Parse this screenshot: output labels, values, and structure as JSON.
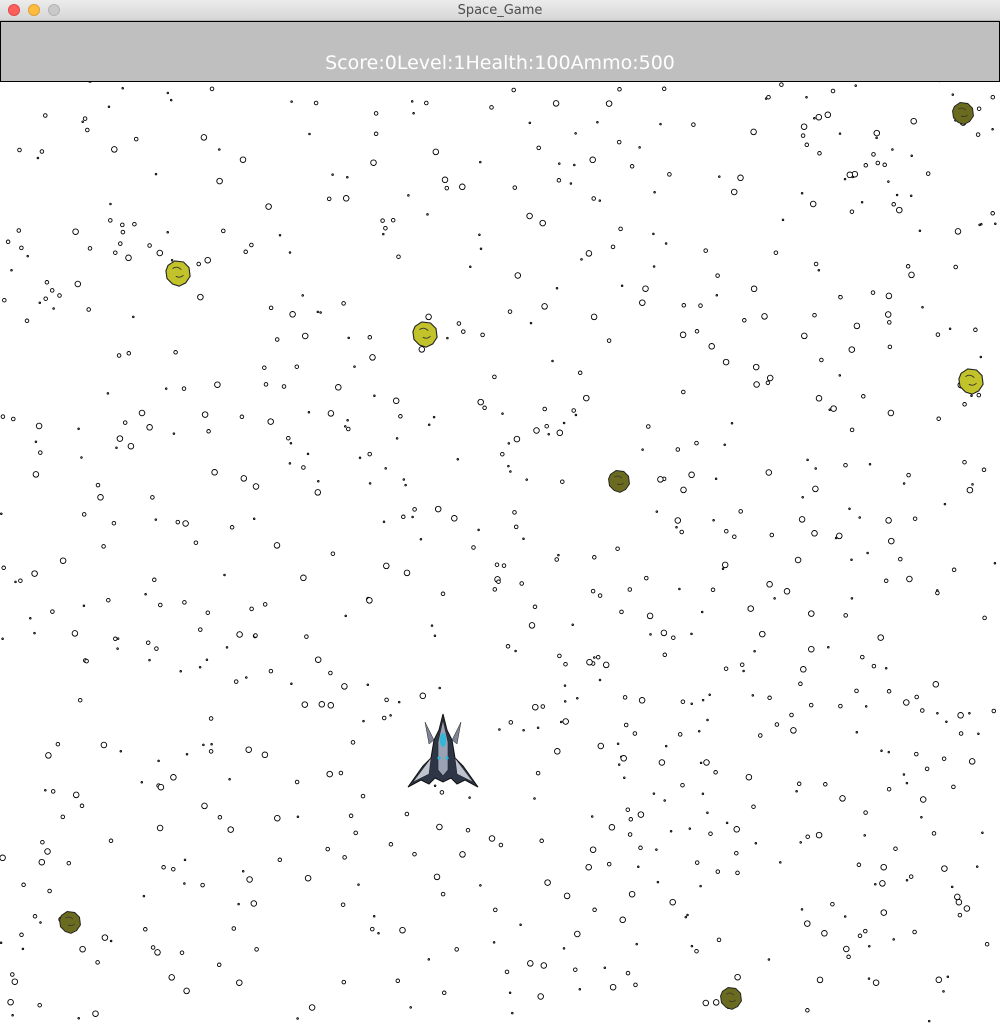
{
  "window": {
    "title": "Space_Game",
    "controls": [
      "close-button",
      "minimize-button",
      "zoom-button"
    ]
  },
  "hud": {
    "score_label": "Score:",
    "score_value": "0",
    "level_label": "Level:",
    "level_value": "1",
    "health_label": "Health:",
    "health_value": "100",
    "ammo_label": "Ammo:",
    "ammo_value": "500",
    "background_color": "#bfbfbf",
    "text_color": "#ffffff"
  },
  "game": {
    "background_color": "#ffffff",
    "star_style": "small black-outlined circles",
    "player_icon": "spaceship-icon",
    "asteroid_icon": "asteroid-icon",
    "asteroid_colors": {
      "yellow": "#c2c22b",
      "olive": "#6b6b20"
    }
  }
}
